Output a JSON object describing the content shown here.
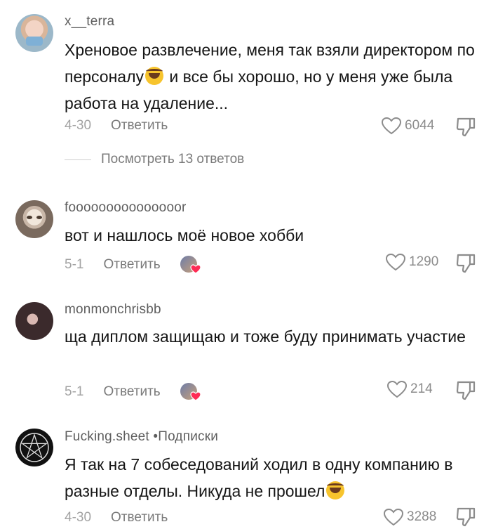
{
  "comments": [
    {
      "username": "x__terra",
      "text_parts": [
        "Хреновое развлечение, меня так взяли директором по персоналу",
        " и все бы хорошо, но у меня уже была работа на удаление..."
      ],
      "date": "4-30",
      "reply_label": "Ответить",
      "likes": "6044",
      "view_replies": "Посмотреть 13 ответов"
    },
    {
      "username": "fooooooooooooooor",
      "text": "вот и нашлось моё новое хобби",
      "date": "5-1",
      "reply_label": "Ответить",
      "likes": "1290"
    },
    {
      "username": "monmonchrisbb",
      "text": "ща диплом защищаю и тоже буду принимать участие",
      "date": "5-1",
      "reply_label": "Ответить",
      "likes": "214"
    },
    {
      "username": "Fucking.sheet",
      "tag": " •Подписки",
      "text_parts": [
        "Я так на 7 собеседований ходил в одну компанию в разные отделы. Никуда не прошел",
        ""
      ],
      "date": "4-30",
      "reply_label": "Ответить",
      "likes": "3288"
    }
  ],
  "icons": {
    "like": "heart-outline-icon",
    "dislike": "thumbs-down-icon",
    "emoji": "laughing-tears-emoji",
    "creator_liked": "creator-liked-avatar-icon"
  },
  "colors": {
    "text": "#161616",
    "muted": "#8c8c8c",
    "heart": "#fe2c55"
  }
}
